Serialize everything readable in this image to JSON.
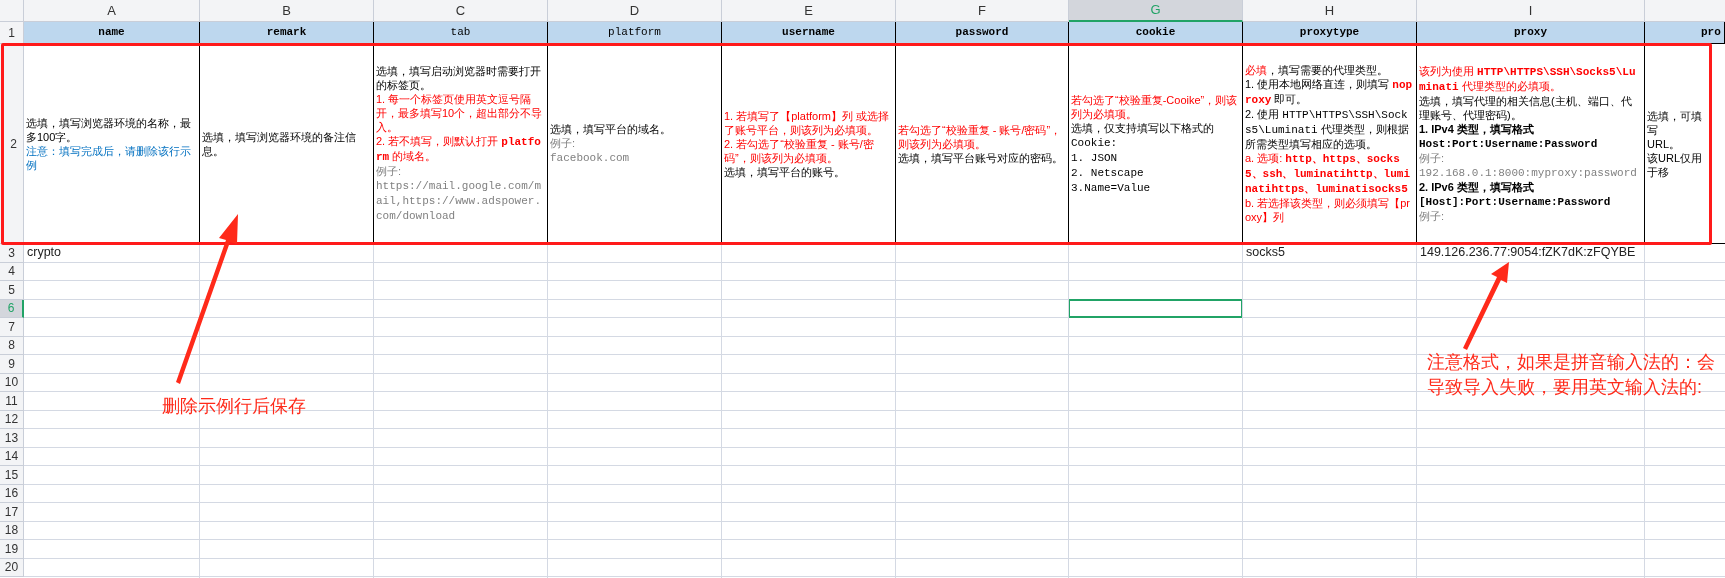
{
  "column_letters": [
    {
      "text": "A",
      "selected": false
    },
    {
      "text": "B",
      "selected": false
    },
    {
      "text": "C",
      "selected": false
    },
    {
      "text": "D",
      "selected": false
    },
    {
      "text": "E",
      "selected": false
    },
    {
      "text": "F",
      "selected": false
    },
    {
      "text": "G",
      "selected": true
    },
    {
      "text": "H",
      "selected": false
    },
    {
      "text": "I",
      "selected": false
    }
  ],
  "row_numbers": [
    {
      "text": "1",
      "selected": false
    },
    {
      "text": "2",
      "selected": false
    },
    {
      "text": "3",
      "selected": false
    },
    {
      "text": "4",
      "selected": false
    },
    {
      "text": "5",
      "selected": false
    },
    {
      "text": "6",
      "selected": true
    },
    {
      "text": "7",
      "selected": false
    },
    {
      "text": "8",
      "selected": false
    },
    {
      "text": "9",
      "selected": false
    },
    {
      "text": "10",
      "selected": false
    },
    {
      "text": "11",
      "selected": false
    },
    {
      "text": "12",
      "selected": false
    },
    {
      "text": "13",
      "selected": false
    },
    {
      "text": "14",
      "selected": false
    },
    {
      "text": "15",
      "selected": false
    },
    {
      "text": "16",
      "selected": false
    },
    {
      "text": "17",
      "selected": false
    },
    {
      "text": "18",
      "selected": false
    },
    {
      "text": "19",
      "selected": false
    },
    {
      "text": "20",
      "selected": false
    }
  ],
  "header_cells": [
    {
      "text": "name",
      "bold": true
    },
    {
      "text": "remark",
      "bold": true
    },
    {
      "text": "tab",
      "bold": false
    },
    {
      "text": "platform",
      "bold": false
    },
    {
      "text": "username",
      "bold": true
    },
    {
      "text": "password",
      "bold": true
    },
    {
      "text": "cookie",
      "bold": true
    },
    {
      "text": "proxytype",
      "bold": true
    },
    {
      "text": "proxy",
      "bold": true
    },
    {
      "text": "pro",
      "bold": true
    }
  ],
  "example_row_cells": [
    {
      "lines": [
        [
          {
            "kind": "normal",
            "text": "选填，填写浏览器环境的名称，最多100字。"
          }
        ],
        [
          {
            "kind": "note",
            "text": "注意：填写完成后，请删除该行示例"
          }
        ]
      ]
    },
    {
      "lines": [
        [
          {
            "kind": "normal",
            "text": "选填，填写浏览器环境的备注信息。"
          }
        ]
      ]
    },
    {
      "lines": [
        [
          {
            "kind": "normal",
            "text": "选填，填写启动浏览器时需要打开的标签页。"
          }
        ],
        [
          {
            "kind": "red",
            "text": "1. 每一个标签页使用英文逗号隔开，最多填写10个，超出部分不导入。"
          }
        ],
        [
          {
            "kind": "red",
            "text": "2. 若不填写，则默认打开 "
          },
          {
            "kind": "redcode",
            "text": "platform"
          },
          {
            "kind": "red",
            "text": " 的域名。"
          }
        ],
        [
          {
            "kind": "example",
            "text": "例子:"
          }
        ],
        [
          {
            "kind": "examplecode",
            "text": "https://mail.google.com/mail,https://www.adspower.com/download"
          }
        ]
      ]
    },
    {
      "lines": [
        [
          {
            "kind": "normal",
            "text": "选填，填写平台的域名。"
          }
        ],
        [
          {
            "kind": "example",
            "text": "例子:"
          }
        ],
        [
          {
            "kind": "examplecode",
            "text": "facebook.com"
          }
        ]
      ]
    },
    {
      "lines": [
        [
          {
            "kind": "red",
            "text": "1. 若填写了【platform】列 或选择了账号平台，则该列为必填项。"
          }
        ],
        [
          {
            "kind": "red",
            "text": "2. 若勾选了“校验重复 - 账号/密码”，则该列为必填项。"
          }
        ],
        [
          {
            "kind": "normal",
            "text": "选填，填写平台的账号。"
          }
        ]
      ]
    },
    {
      "lines": [
        [
          {
            "kind": "red",
            "text": "若勾选了“校验重复 - 账号/密码”，则该列为必填项。"
          }
        ],
        [
          {
            "kind": "normal",
            "text": "选填，填写平台账号对应的密码。"
          }
        ]
      ]
    },
    {
      "lines": [
        [
          {
            "kind": "red",
            "text": "若勾选了“校验重复-Cooike”，则该列为必填项。"
          }
        ],
        [
          {
            "kind": "normal",
            "text": "选填，仅支持填写以下格式的"
          }
        ],
        [
          {
            "kind": "code",
            "text": "Cookie:"
          }
        ],
        [
          {
            "kind": "code",
            "text": "1. JSON"
          }
        ],
        [
          {
            "kind": "code",
            "text": "2. Netscape"
          }
        ],
        [
          {
            "kind": "code",
            "text": "3.Name=Value"
          }
        ]
      ]
    },
    {
      "lines": [
        [
          {
            "kind": "red",
            "text": "必填"
          },
          {
            "kind": "normal",
            "text": "，填写需要的代理类型。"
          }
        ],
        [
          {
            "kind": "normal",
            "text": "1. 使用本地网络直连，则填写 "
          },
          {
            "kind": "redcode",
            "text": "noproxy"
          },
          {
            "kind": "normal",
            "text": " 即可。"
          }
        ],
        [
          {
            "kind": "normal",
            "text": "2. 使用 "
          },
          {
            "kind": "code",
            "text": "HTTP\\HTTPS\\SSH\\Socks5\\Luminati"
          },
          {
            "kind": "normal",
            "text": " 代理类型，则根据所需类型填写相应的选项。"
          }
        ],
        [
          {
            "kind": "red",
            "text": "a. 选项: "
          },
          {
            "kind": "redcode",
            "text": "http、https、socks5、ssh、luminatihttp、luminatihttps、luminatisocks5"
          }
        ],
        [
          {
            "kind": "red",
            "text": "b. 若选择该类型，则必须填写【proxy】列"
          }
        ]
      ]
    },
    {
      "lines": [
        [
          {
            "kind": "red",
            "text": "该列为使用 "
          },
          {
            "kind": "redcode",
            "text": "HTTP\\HTTPS\\SSH\\Socks5\\Luminati"
          },
          {
            "kind": "red",
            "text": " 代理类型的必填项。"
          }
        ],
        [
          {
            "kind": "normal",
            "text": "选填，填写代理的相关信息(主机、端口、代理账号、代理密码)。"
          }
        ],
        [
          {
            "kind": "bold",
            "text": "1. IPv4 类型，填写格式"
          }
        ],
        [
          {
            "kind": "boldcode",
            "text": "Host:Port:Username:Password"
          }
        ],
        [
          {
            "kind": "example",
            "text": "例子:"
          }
        ],
        [
          {
            "kind": "examplecode",
            "text": "192.168.0.1:8000:myproxy:password"
          }
        ],
        [
          {
            "kind": "bold",
            "text": "2. IPv6 类型，填写格式"
          }
        ],
        [
          {
            "kind": "boldcode",
            "text": "[Host]:Port:Username:Password"
          }
        ],
        [
          {
            "kind": "example",
            "text": "例子:"
          }
        ]
      ]
    },
    {
      "lines": [
        [
          {
            "kind": "normal",
            "text": "选填，可填写"
          }
        ],
        [
          {
            "kind": "normal",
            "text": "URL。"
          }
        ],
        [
          {
            "kind": "normal",
            "text": "该URL仅用于移"
          }
        ]
      ]
    }
  ],
  "data_row_cells": [
    "crypto",
    null,
    null,
    null,
    null,
    null,
    null,
    "socks5",
    "149.126.236.77:9054:fZK7dK:zFQYBE",
    null
  ],
  "annotations": [
    {
      "text": "删除示例行后保存"
    },
    {
      "text": "注意格式，如果是拼音输入法的：会导致导入失败，要用英文输入法的:"
    }
  ]
}
